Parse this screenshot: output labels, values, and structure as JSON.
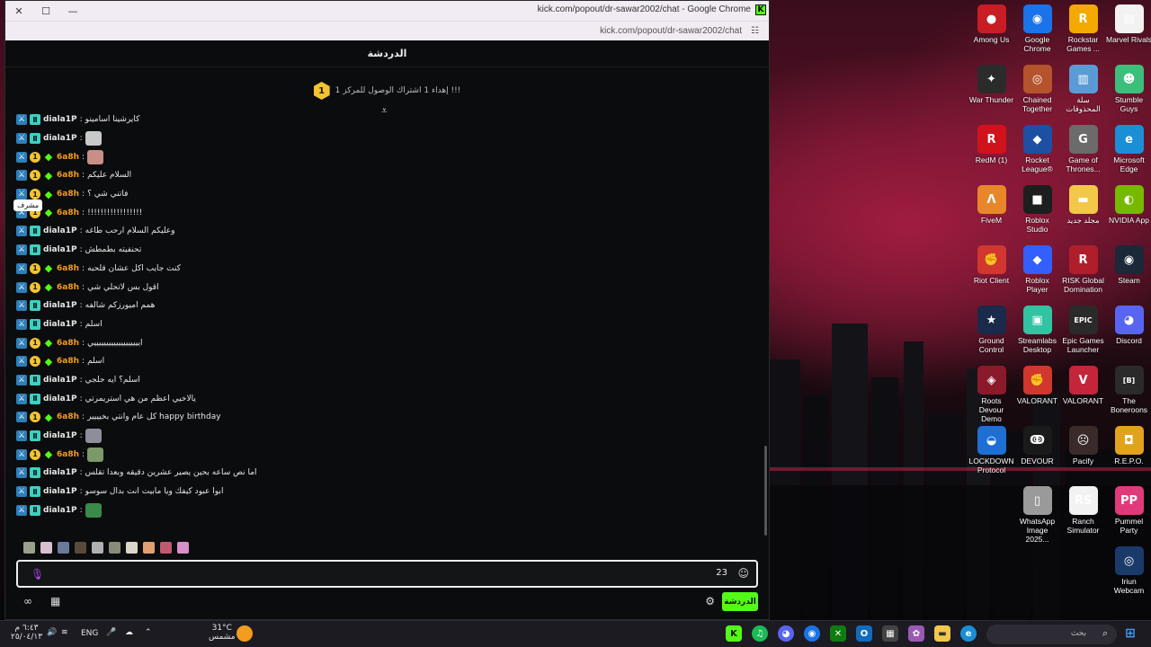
{
  "window": {
    "title": "kick.com/popout/dr-sawar2002/chat - Google Chrome",
    "url": "kick.com/popout/dr-sawar2002/chat"
  },
  "chat": {
    "header": "الدردشة",
    "pinned": {
      "level": "1",
      "text": "إهداء 1 اشتراك الوصول للمركز 1 !!!"
    },
    "tooltip": "مشرف",
    "messages": [
      {
        "user": "diala1P",
        "color": "white",
        "badges": [
          "mod",
          "vip"
        ],
        "text": "كايرشينا اسامينو",
        "emote": ""
      },
      {
        "user": "diala1P",
        "color": "white",
        "badges": [
          "mod",
          "vip"
        ],
        "text": "",
        "emote": "#c9c9c9"
      },
      {
        "user": "6a8h",
        "color": "orange",
        "badges": [
          "mod",
          "sub",
          "og"
        ],
        "text": "",
        "emote": "#c98f86"
      },
      {
        "user": "6a8h",
        "color": "orange",
        "badges": [
          "mod",
          "sub",
          "og"
        ],
        "text": "السلام عليكم",
        "emote": ""
      },
      {
        "user": "6a8h",
        "color": "orange",
        "badges": [
          "mod",
          "sub",
          "og"
        ],
        "text": "فاتني شي ؟",
        "emote": ""
      },
      {
        "user": "6a8h",
        "color": "orange",
        "badges": [
          "mod",
          "sub",
          "og"
        ],
        "text": "!!!!!!!!!!!!!!!!!",
        "emote": ""
      },
      {
        "user": "diala1P",
        "color": "white",
        "badges": [
          "mod",
          "vip"
        ],
        "text": "وعليكم السلام ارحب طاغه",
        "emote": ""
      },
      {
        "user": "diala1P",
        "color": "white",
        "badges": [
          "mod",
          "vip"
        ],
        "text": "تحنفيته بطمطش",
        "emote": ""
      },
      {
        "user": "6a8h",
        "color": "orange",
        "badges": [
          "mod",
          "sub",
          "og"
        ],
        "text": "كنت جايب اكل عشان قلحبه",
        "emote": ""
      },
      {
        "user": "6a8h",
        "color": "orange",
        "badges": [
          "mod",
          "sub",
          "og"
        ],
        "text": "اقول بس لاتحلي شي",
        "emote": ""
      },
      {
        "user": "diala1P",
        "color": "white",
        "badges": [
          "mod",
          "vip"
        ],
        "text": "همم اميورزكم شالفه",
        "emote": ""
      },
      {
        "user": "diala1P",
        "color": "white",
        "badges": [
          "mod",
          "vip"
        ],
        "text": "اسلم",
        "emote": ""
      },
      {
        "user": "6a8h",
        "color": "orange",
        "badges": [
          "mod",
          "sub",
          "og"
        ],
        "text": "ايييييييييييييييييييي",
        "emote": ""
      },
      {
        "user": "6a8h",
        "color": "orange",
        "badges": [
          "mod",
          "sub",
          "og"
        ],
        "text": "اسلم",
        "emote": ""
      },
      {
        "user": "diala1P",
        "color": "white",
        "badges": [
          "mod",
          "vip"
        ],
        "text": "اسلم؟ ايه حلجي",
        "emote": ""
      },
      {
        "user": "diala1P",
        "color": "white",
        "badges": [
          "mod",
          "vip"
        ],
        "text": "يالاخيي اعظم من هي استريمرتي",
        "emote": ""
      },
      {
        "user": "6a8h",
        "color": "orange",
        "badges": [
          "mod",
          "sub",
          "og"
        ],
        "text": "كل عام وانتي بخيييير happy birthday",
        "emote": ""
      },
      {
        "user": "diala1P",
        "color": "white",
        "badges": [
          "mod",
          "vip"
        ],
        "text": "",
        "emote": "#8e8e9a"
      },
      {
        "user": "6a8h",
        "color": "orange",
        "badges": [
          "mod",
          "sub",
          "og"
        ],
        "text": "",
        "emote": "#7a9a6a"
      },
      {
        "user": "diala1P",
        "color": "white",
        "badges": [
          "mod",
          "vip"
        ],
        "text": "اما نص ساعه بحين يصير عشرين دقيقه وبعدا تقلس",
        "emote": ""
      },
      {
        "user": "diala1P",
        "color": "white",
        "badges": [
          "mod",
          "vip"
        ],
        "text": "ابوا عبود كيفك ويا مابيت انت بدال سوسو",
        "emote": ""
      },
      {
        "user": "diala1P",
        "color": "white",
        "badges": [
          "mod",
          "vip"
        ],
        "text": "",
        "emote": "#3a8a4a"
      }
    ],
    "emote_colors": [
      "#9aa08a",
      "#d8c0d0",
      "#6a7a9a",
      "#5a4a3a",
      "#b0b0b0",
      "#8a8a7a",
      "#d8d8c8",
      "#e0a070",
      "#c05a70",
      "#d890c8"
    ],
    "input": {
      "counter": "23"
    },
    "send_label": "الدردشة"
  },
  "desktop_icons": [
    {
      "label": "Among Us",
      "color": "#c81d25",
      "glyph": "●"
    },
    {
      "label": "Google Chrome",
      "color": "#1a73e8",
      "glyph": "◉"
    },
    {
      "label": "Rockstar Games ...",
      "color": "#f4a900",
      "glyph": "R"
    },
    {
      "label": "Marvel Rivals",
      "color": "#f2f2f2",
      "glyph": "▤"
    },
    {
      "label": "War Thunder",
      "color": "#2b2b2b",
      "glyph": "✦"
    },
    {
      "label": "Chained Together",
      "color": "#b5532c",
      "glyph": "◎"
    },
    {
      "label": "سلة المحذوفات",
      "color": "#5a9bd5",
      "glyph": "▥"
    },
    {
      "label": "Stumble Guys",
      "color": "#3bbf7a",
      "glyph": "☻"
    },
    {
      "label": "RedM (1)",
      "color": "#d0121b",
      "glyph": "R"
    },
    {
      "label": "Rocket League®",
      "color": "#1d4fa3",
      "glyph": "◆"
    },
    {
      "label": "Game of Thrones...",
      "color": "#6b6b6b",
      "glyph": "G"
    },
    {
      "label": "Microsoft Edge",
      "color": "#1a8fd6",
      "glyph": "e"
    },
    {
      "label": "FiveM",
      "color": "#e8872a",
      "glyph": "Λ"
    },
    {
      "label": "Roblox Studio",
      "color": "#1e1e1e",
      "glyph": "■"
    },
    {
      "label": "مجلد جديد",
      "color": "#f2c74a",
      "glyph": "▬"
    },
    {
      "label": "NVIDIA App",
      "color": "#76b900",
      "glyph": "◐"
    },
    {
      "label": "Riot Client",
      "color": "#d1362f",
      "glyph": "✊"
    },
    {
      "label": "Roblox Player",
      "color": "#335fff",
      "glyph": "◆"
    },
    {
      "label": "RISK Global Domination",
      "color": "#b11e2b",
      "glyph": "R"
    },
    {
      "label": "Steam",
      "color": "#1b2838",
      "glyph": "◉"
    },
    {
      "label": "Ground Control",
      "color": "#1a2a4a",
      "glyph": "★"
    },
    {
      "label": "Streamlabs Desktop",
      "color": "#31c3a2",
      "glyph": "▣"
    },
    {
      "label": "Epic Games Launcher",
      "color": "#2a2a2a",
      "glyph": "EPIC"
    },
    {
      "label": "Discord",
      "color": "#5865f2",
      "glyph": "◕"
    },
    {
      "label": "Roots Devour Demo",
      "color": "#8a1a2a",
      "glyph": "◈"
    },
    {
      "label": "VALORANT",
      "color": "#d1362f",
      "glyph": "✊"
    },
    {
      "label": "VALORANT",
      "color": "#c5253a",
      "glyph": "V"
    },
    {
      "label": "The Boneroons",
      "color": "#2a2a2a",
      "glyph": "[B]"
    },
    {
      "label": "LOCKDOWN Protocol",
      "color": "#1d6fd6",
      "glyph": "◒"
    },
    {
      "label": "DEVOUR",
      "color": "#1a1a1a",
      "glyph": "ↂ"
    },
    {
      "label": "Pacify",
      "color": "#3a2a2a",
      "glyph": "☹"
    },
    {
      "label": "R.E.P.O.",
      "color": "#e2a21c",
      "glyph": "◘"
    },
    {
      "label": "",
      "color": "",
      "glyph": ""
    },
    {
      "label": "WhatsApp Image 2025...",
      "color": "#9a9a9a",
      "glyph": "▯"
    },
    {
      "label": "Ranch Simulator",
      "color": "#f2f2f2",
      "glyph": "RS"
    },
    {
      "label": "Pummel Party",
      "color": "#e03a7a",
      "glyph": "PP"
    },
    {
      "label": "",
      "color": "",
      "glyph": ""
    },
    {
      "label": "",
      "color": "",
      "glyph": ""
    },
    {
      "label": "",
      "color": "",
      "glyph": ""
    },
    {
      "label": "Iriun Webcam",
      "color": "#1a3a6a",
      "glyph": "◎"
    }
  ],
  "taskbar": {
    "time": "٦:٤٣ م",
    "date": "٢٥/٠٤/١٣",
    "language": "ENG",
    "temperature": "31°C",
    "weather": "مشمس",
    "search_placeholder": "بحث"
  }
}
